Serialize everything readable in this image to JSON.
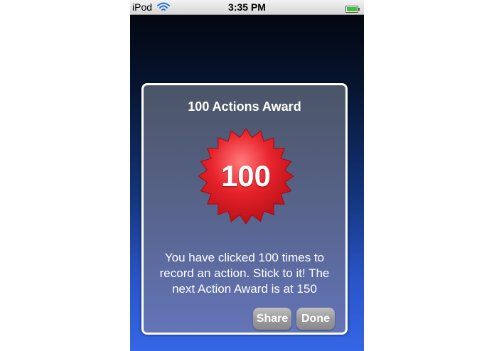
{
  "status_bar": {
    "carrier": "iPod",
    "time": "3:35 PM"
  },
  "dialog": {
    "title": "100 Actions Award",
    "badge_number": "100",
    "message": "You have clicked 100 times to record an action. Stick to it! The next Action Award is at 150",
    "share_label": "Share",
    "done_label": "Done"
  },
  "colors": {
    "badge_red": "#e01b24",
    "dialog_border": "#ffffff",
    "button_gray": "#9b9b9b"
  }
}
